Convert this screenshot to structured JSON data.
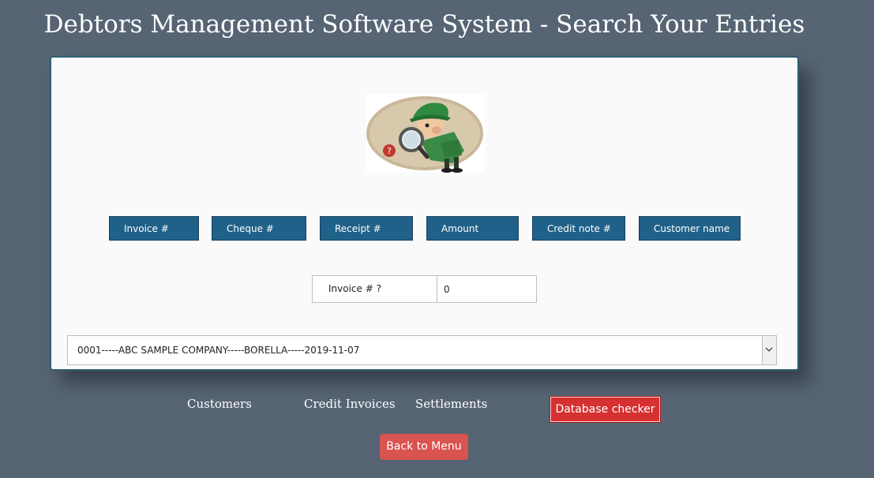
{
  "header": {
    "title": "Debtors Management Software System - Search Your Entries"
  },
  "search_buttons": {
    "invoice": "Invoice #",
    "cheque": "Cheque #",
    "receipt": "Receipt #",
    "amount": "Amount",
    "credit_note": "Credit note #",
    "customer_name": "Customer name"
  },
  "query": {
    "label": "Invoice # ?",
    "value": "0"
  },
  "results": {
    "selected": "0001-----ABC SAMPLE COMPANY-----BORELLA-----2019-11-07"
  },
  "nav": {
    "customers": "Customers",
    "credit_invoices": "Credit Invoices",
    "settlements": "Settlements",
    "database_checker": "Database checker",
    "back_to_menu": "Back to Menu"
  },
  "colors": {
    "background": "#566474",
    "button_blue": "#1f6189",
    "danger_red": "#d63030",
    "back_red": "#d9534f"
  }
}
